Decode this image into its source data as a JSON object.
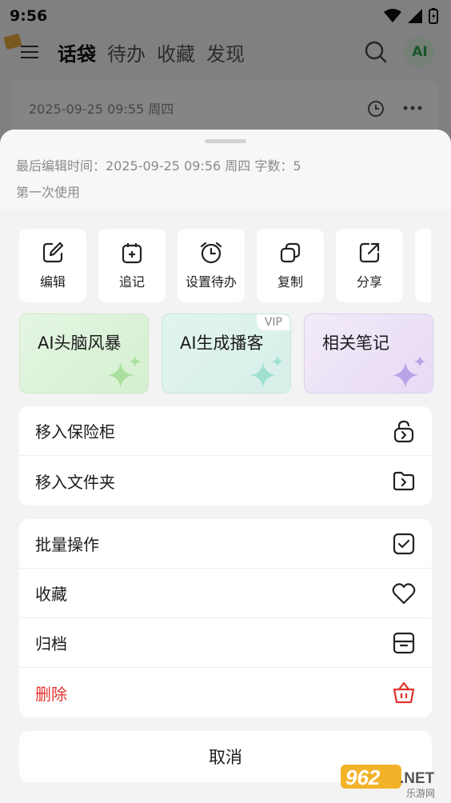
{
  "status_bar": {
    "time": "9:56"
  },
  "header": {
    "tabs": [
      {
        "label": "话袋",
        "active": true
      },
      {
        "label": "待办",
        "active": false
      },
      {
        "label": "收藏",
        "active": false
      },
      {
        "label": "发现",
        "active": false
      }
    ],
    "ai_label": "AI"
  },
  "note_card": {
    "date": "2025-09-25 09:55 周四"
  },
  "sheet": {
    "meta": "最后编辑时间：2025-09-25 09:56 周四 字数：5",
    "subtitle": "第一次使用",
    "actions": [
      {
        "label": "编辑",
        "icon": "edit-icon"
      },
      {
        "label": "追记",
        "icon": "append-note-icon"
      },
      {
        "label": "设置待办",
        "icon": "alarm-clock-icon"
      },
      {
        "label": "复制",
        "icon": "copy-icon"
      },
      {
        "label": "分享",
        "icon": "share-icon"
      }
    ],
    "ai_cards": [
      {
        "label": "AI头脑风暴",
        "color": "#d4efcf"
      },
      {
        "label": "AI生成播客",
        "tag": "VIP",
        "color": "#d7efe9"
      },
      {
        "label": "相关笔记",
        "color": "#e6daf6"
      }
    ],
    "group1": [
      {
        "label": "移入保险柜",
        "icon": "lock-icon"
      },
      {
        "label": "移入文件夹",
        "icon": "folder-move-icon"
      }
    ],
    "group2": [
      {
        "label": "批量操作",
        "icon": "checkbox-icon"
      },
      {
        "label": "收藏",
        "icon": "heart-icon"
      },
      {
        "label": "归档",
        "icon": "archive-icon"
      },
      {
        "label": "删除",
        "icon": "delete-basket-icon",
        "color": "#e0332c"
      }
    ],
    "cancel_label": "取消"
  },
  "watermark": {
    "brand": "962",
    "suffix": ".NET",
    "sub": "乐游网"
  }
}
